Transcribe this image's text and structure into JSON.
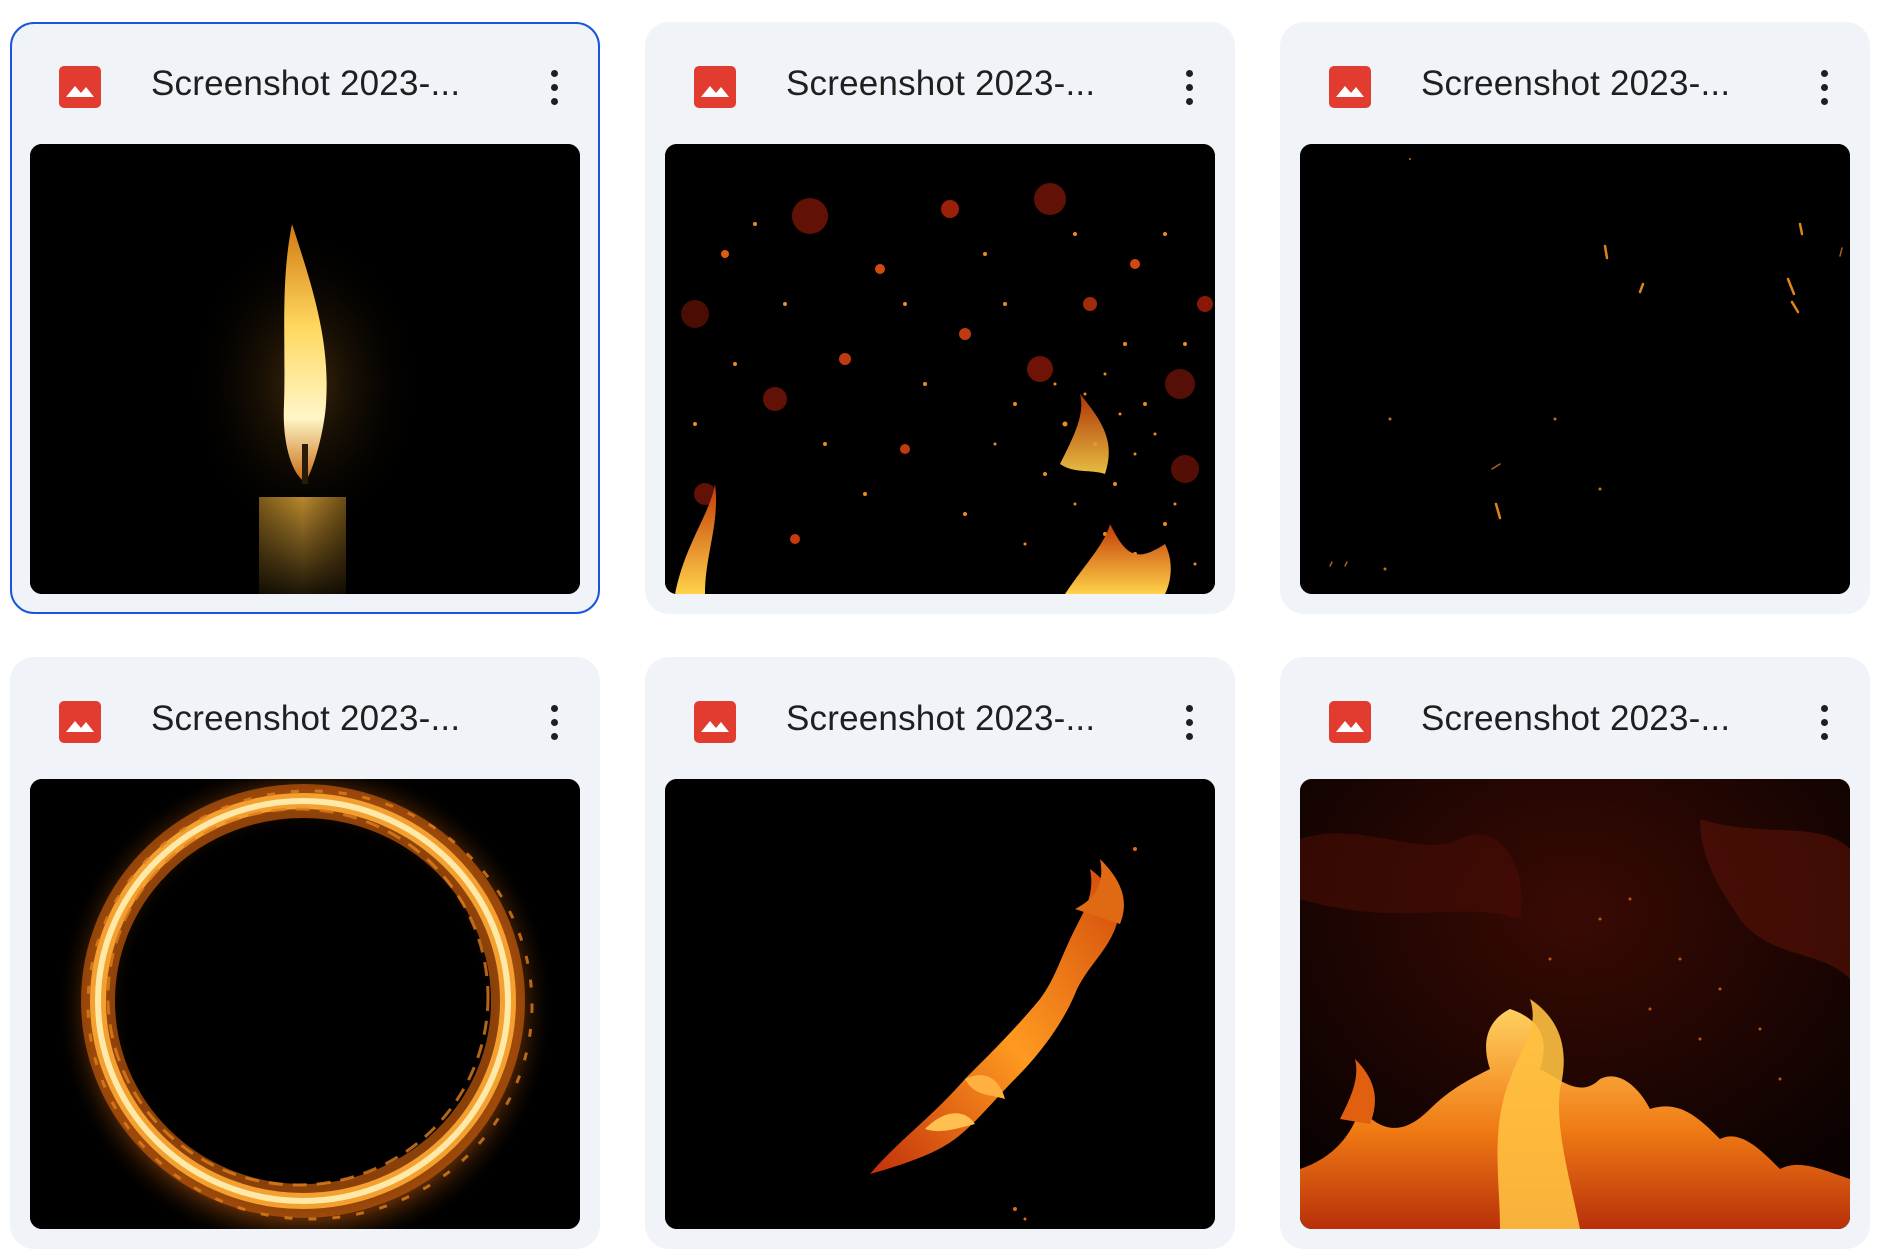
{
  "files": [
    {
      "title": "Screenshot 2023-...",
      "icon": "image-file-icon",
      "thumbnail": "candle-flame",
      "selected": true
    },
    {
      "title": "Screenshot 2023-...",
      "icon": "image-file-icon",
      "thumbnail": "fire-embers-particles",
      "selected": false
    },
    {
      "title": "Screenshot 2023-...",
      "icon": "image-file-icon",
      "thumbnail": "sparse-sparks",
      "selected": false
    },
    {
      "title": "Screenshot 2023-...",
      "icon": "image-file-icon",
      "thumbnail": "ring-of-fire",
      "selected": false
    },
    {
      "title": "Screenshot 2023-...",
      "icon": "image-file-icon",
      "thumbnail": "fire-streak",
      "selected": false
    },
    {
      "title": "Screenshot 2023-...",
      "icon": "image-file-icon",
      "thumbnail": "flames-and-smoke",
      "selected": false
    }
  ],
  "colors": {
    "card_bg": "#f0f4f9",
    "selected_border": "#1a56db",
    "file_icon": "#e23b2f",
    "text": "#1f1f1f"
  }
}
